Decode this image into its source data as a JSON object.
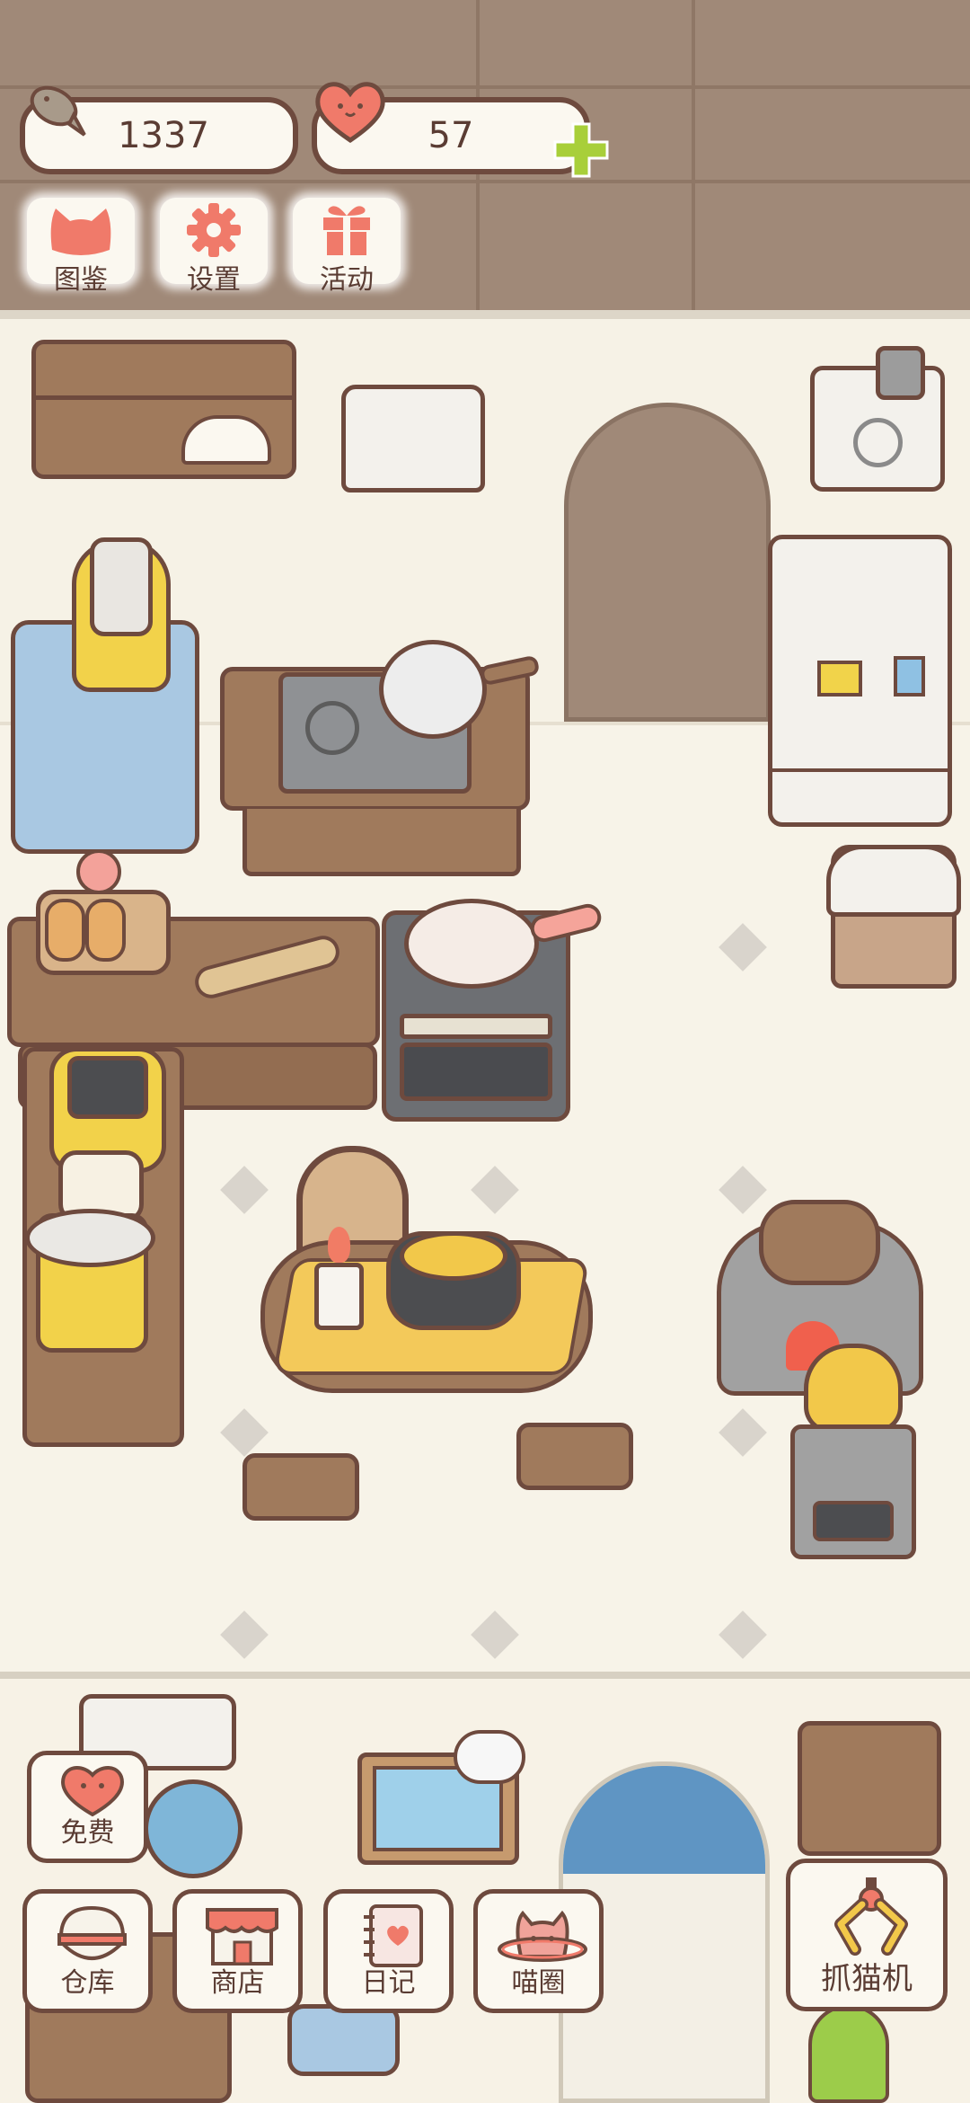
{
  "hud": {
    "fish_count": "1337",
    "heart_count": "57",
    "plus_symbol": "+"
  },
  "top_menu": [
    {
      "label": "图鉴",
      "icon": "cat-head-icon"
    },
    {
      "label": "设置",
      "icon": "gear-icon"
    },
    {
      "label": "活动",
      "icon": "gift-icon"
    }
  ],
  "bottom_menu": {
    "free": "免费",
    "warehouse": "仓库",
    "shop": "商店",
    "diary": "日记",
    "circle": "喵圈",
    "claw": "抓猫机"
  },
  "colors": {
    "wall": "#a08978",
    "floor": "#f7f3e8",
    "outline": "#6e4a3e",
    "accent_pink": "#f07a6a",
    "accent_green": "#a8cf3a"
  }
}
